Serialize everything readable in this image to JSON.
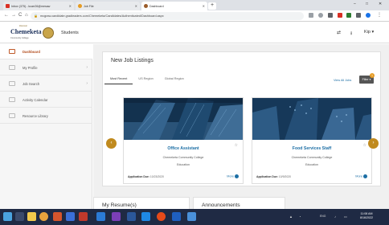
{
  "browser": {
    "tabs": [
      {
        "label": "Inbox (375) - kcarr26@mesaw",
        "favicon_color": "#d93025",
        "active": false
      },
      {
        "label": "Job File",
        "favicon_color": "#e69b22",
        "active": false
      },
      {
        "label": "Dashboard",
        "favicon_color": "#9a5c2a",
        "active": true
      }
    ],
    "new_tab": "+",
    "address": "mcgraw.candidate.gradleaders.com/Chemeketa/Candidates/Authenticated/Dashboard.aspx",
    "win_controls": {
      "minimize": "–",
      "maximize": "□",
      "close": "✕"
    },
    "nav": {
      "back": "←",
      "forward": "→",
      "reload": "C",
      "home": "⌂"
    }
  },
  "header": {
    "logo_kicker": "Discover",
    "logo_text": "Chemeketa",
    "logo_sub": "Community College",
    "brand_section": "Students",
    "user_label": "Kip",
    "user_chevron": "▾"
  },
  "sidebar": {
    "items": [
      {
        "label": "Dashboard",
        "active": true,
        "chevron": ""
      },
      {
        "label": "My Profile",
        "active": false,
        "chevron": "›"
      },
      {
        "label": "Job Search",
        "active": false,
        "chevron": "›"
      },
      {
        "label": "Activity Calendar",
        "active": false,
        "chevron": ""
      },
      {
        "label": "Resource Library",
        "active": false,
        "chevron": ""
      }
    ]
  },
  "listings": {
    "title": "New Job Listings",
    "tabs": [
      "Most Recent",
      "US Region",
      "Global Region"
    ],
    "active_tab": "Most Recent",
    "view_all": "View All Jobs",
    "filter_label": "Filter ▾",
    "filter_badge": "1",
    "prev_arrow": "‹",
    "next_arrow": "›",
    "cards": [
      {
        "title": "Office Assistant",
        "org": "Chemeketa Community College",
        "category": "Education",
        "due_label": "Application Due:",
        "due_date": "10/23/2020",
        "more": "More"
      },
      {
        "title": "Food Services Staff",
        "org": "Chemeketa Community College",
        "category": "Education",
        "due_label": "Application Due:",
        "due_date": "10/9/2020",
        "more": "More"
      }
    ]
  },
  "bottom": {
    "resume": "My Resume(s)",
    "announcements": "Announcements"
  },
  "taskbar": {
    "time": "11:08 AM",
    "date": "8/16/2022",
    "lang": "ENG",
    "icons": [
      "start-icon",
      "search-icon",
      "file-explorer-icon",
      "chrome-icon",
      "teams-icon",
      "files-icon",
      "store-icon",
      "onenote-icon",
      "word-icon",
      "office-icon",
      "edge-icon",
      "settings-icon"
    ]
  }
}
